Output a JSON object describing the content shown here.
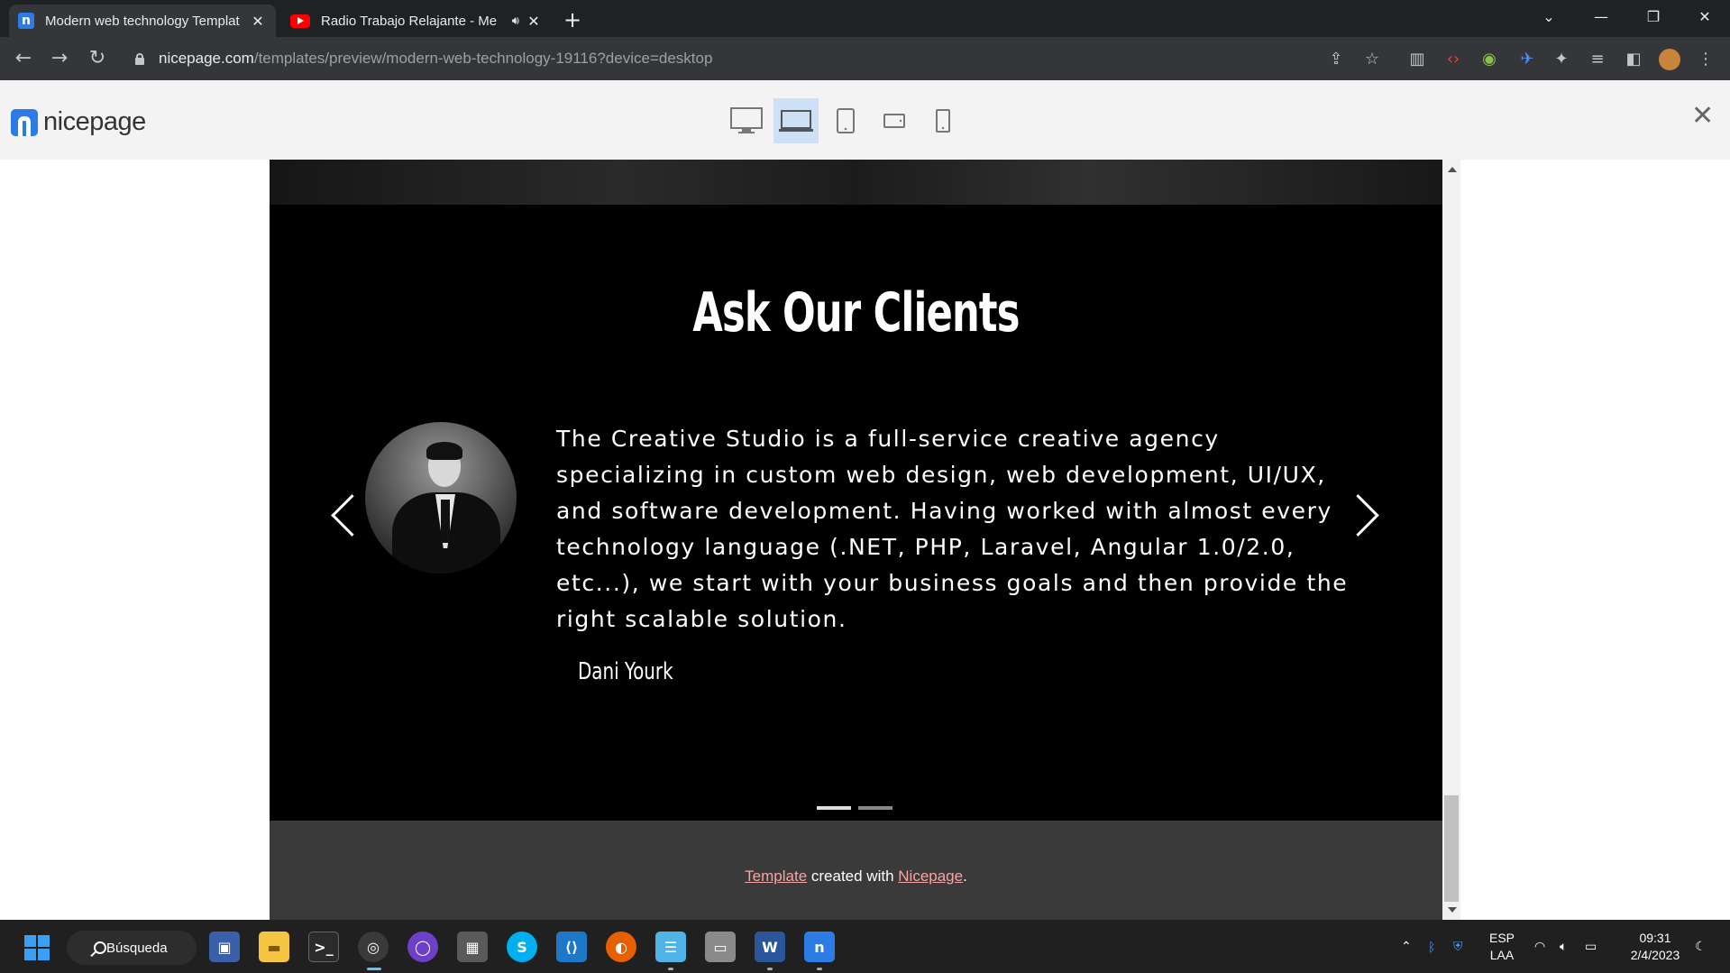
{
  "browser": {
    "tabs": [
      {
        "title": "Modern web technology Templat",
        "active": true
      },
      {
        "title": "Radio Trabajo Relajante - Me",
        "active": false
      }
    ],
    "address": {
      "host": "nicepage.com",
      "path": "/templates/preview/modern-web-technology-19116?device=desktop"
    }
  },
  "nicepage": {
    "logo_text": "nicepage",
    "devices": [
      "desktop",
      "laptop",
      "tablet",
      "phone-landscape",
      "phone"
    ],
    "selected_device": "laptop"
  },
  "page": {
    "section_title": "Ask Our Clients",
    "testimonial": {
      "quote": "The Creative Studio is a full-service creative agency specializing in custom web design, web development, UI/UX, and software development. Having worked with almost every technology language (.NET, PHP, Laravel, Angular 1.0/2.0, etc...), we start with your business goals and then provide the right scalable solution.",
      "author": "Dani Yourk"
    },
    "slider": {
      "count": 2,
      "active_index": 0
    },
    "footer": {
      "link1": "Template",
      "middle": " created with ",
      "link2": "Nicepage",
      "end": "."
    }
  },
  "taskbar": {
    "search_label": "Búsqueda",
    "lang_top": "ESP",
    "lang_bottom": "LAA",
    "time": "09:31",
    "date": "2/4/2023"
  }
}
